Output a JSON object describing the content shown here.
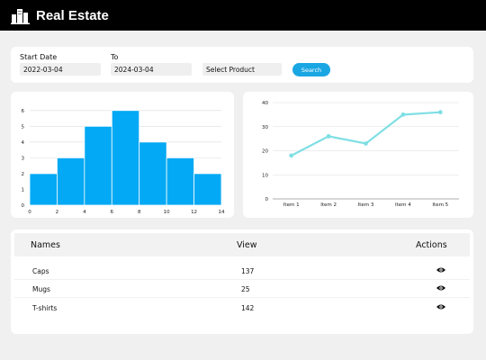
{
  "app": {
    "title": "Real Estate"
  },
  "filters": {
    "start_label": "Start Date",
    "start_value": "2022-03-04",
    "to_label": "To",
    "to_value": "2024-03-04",
    "product_label": "Select Product",
    "search_label": "Search"
  },
  "chart_data": [
    {
      "type": "bar",
      "x_edges": [
        0,
        2,
        4,
        6,
        8,
        10,
        12,
        14
      ],
      "values": [
        2,
        3,
        5,
        6,
        4,
        3,
        2
      ],
      "xticks": [
        "0",
        "2",
        "4",
        "6",
        "8",
        "10",
        "12",
        "14"
      ],
      "yticks": [
        "0",
        "1",
        "2",
        "3",
        "4",
        "5",
        "6"
      ],
      "ylim": [
        0,
        6.5
      ],
      "grid": true,
      "color": "#03a9f4"
    },
    {
      "type": "line",
      "categories": [
        "Item 1",
        "Item 2",
        "Item 3",
        "Item 4",
        "Item 5"
      ],
      "values": [
        18,
        26,
        23,
        35,
        36
      ],
      "yticks": [
        "0",
        "10",
        "20",
        "30",
        "40"
      ],
      "ylim": [
        0,
        40
      ],
      "grid": true,
      "color": "#7fdfe4"
    }
  ],
  "table": {
    "headers": {
      "names": "Names",
      "view": "View",
      "actions": "Actions"
    },
    "rows": [
      {
        "name": "Caps",
        "view": "137"
      },
      {
        "name": "Mugs",
        "view": "25"
      },
      {
        "name": "T-shirts",
        "view": "142"
      }
    ]
  }
}
